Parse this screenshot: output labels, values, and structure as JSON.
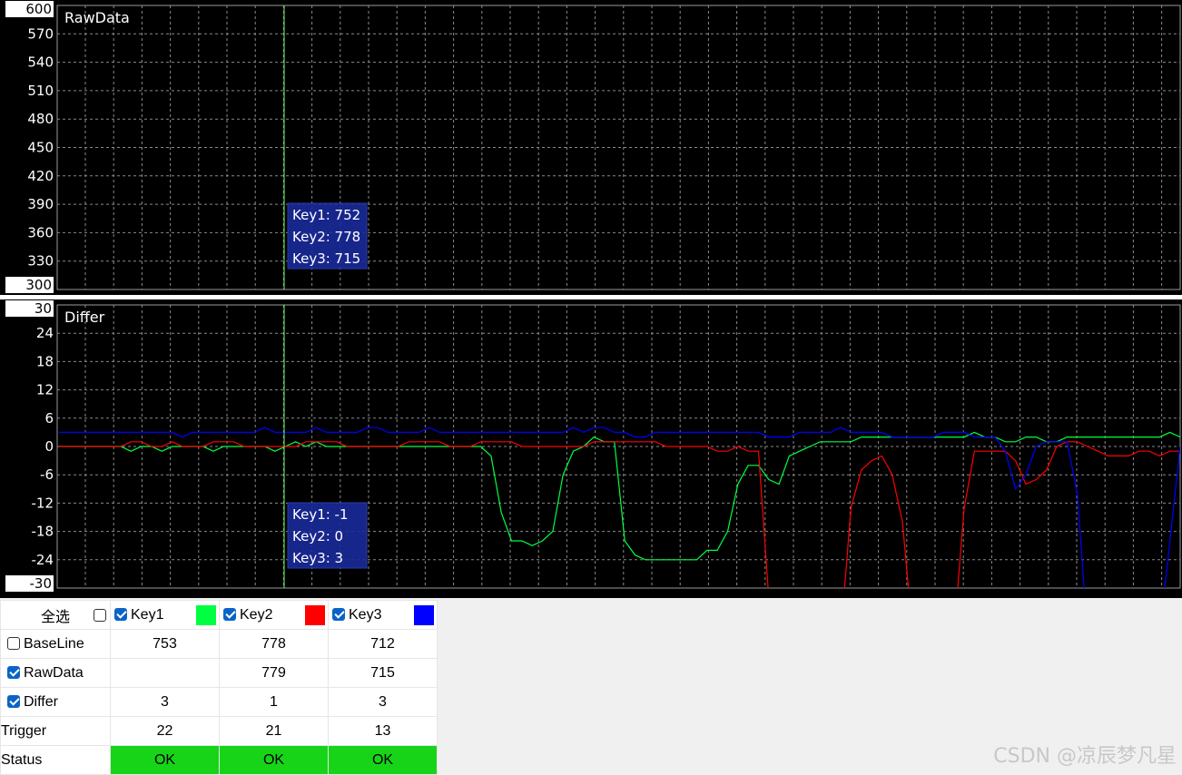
{
  "panels": [
    {
      "title": "RawData",
      "y_ticks": [
        "600",
        "570",
        "540",
        "510",
        "480",
        "450",
        "420",
        "390",
        "360",
        "330",
        "300"
      ],
      "tooltip": [
        "Key1: 752",
        "Key2: 778",
        "Key3: 715"
      ]
    },
    {
      "title": "Differ",
      "y_ticks": [
        "30",
        "24",
        "18",
        "12",
        "6",
        "0",
        "-6",
        "-12",
        "-18",
        "-24",
        "-30"
      ],
      "tooltip": [
        "Key1: -1",
        "Key2: 0",
        "Key3: 3"
      ]
    }
  ],
  "table": {
    "select_all": "全选",
    "keys": [
      {
        "label": "Key1",
        "color": "#00ff40",
        "checked": true
      },
      {
        "label": "Key2",
        "color": "#ff0000",
        "checked": true
      },
      {
        "label": "Key3",
        "color": "#0000ff",
        "checked": true
      }
    ],
    "rows": [
      {
        "label": "BaseLine",
        "checkbox": true,
        "checked": false,
        "values": [
          "753",
          "778",
          "712"
        ]
      },
      {
        "label": "RawData",
        "checkbox": true,
        "checked": true,
        "values": [
          "",
          "779",
          "715"
        ]
      },
      {
        "label": "Differ",
        "checkbox": true,
        "checked": true,
        "values": [
          "3",
          "1",
          "3"
        ]
      },
      {
        "label": "Trigger",
        "checkbox": false,
        "values": [
          "22",
          "21",
          "13"
        ]
      },
      {
        "label": "Status",
        "checkbox": false,
        "values": [
          "OK",
          "OK",
          "OK"
        ]
      }
    ]
  },
  "watermark": "CSDN @凉辰梦凡星",
  "chart_data": [
    {
      "type": "line",
      "title": "RawData",
      "ylim": [
        300,
        600
      ],
      "grid": true,
      "series": [
        {
          "name": "Key1",
          "color": "#00ff40",
          "values": []
        },
        {
          "name": "Key2",
          "color": "#ff0000",
          "values": []
        },
        {
          "name": "Key3",
          "color": "#0000ff",
          "values": []
        }
      ]
    },
    {
      "type": "line",
      "title": "Differ",
      "ylim": [
        -30,
        30
      ],
      "grid": true,
      "series": [
        {
          "name": "Key1",
          "color": "#00ff40",
          "values": [
            0,
            0,
            0,
            0,
            0,
            0,
            0,
            -1,
            0,
            0,
            -1,
            0,
            0,
            0,
            0,
            -1,
            0,
            0,
            0,
            0,
            0,
            -1,
            0,
            1,
            0,
            1,
            0,
            0,
            0,
            0,
            0,
            0,
            0,
            0,
            0,
            0,
            0,
            0,
            0,
            0,
            0,
            0,
            -2,
            -14,
            -20,
            -20,
            -21,
            -20,
            -18,
            -6,
            -1,
            0,
            2,
            1,
            1,
            -20,
            -23,
            -24,
            -24,
            -24,
            -24,
            -24,
            -24,
            -22,
            -22,
            -18,
            -8,
            -4,
            -4,
            -7,
            -8,
            -2,
            -1,
            0,
            1,
            1,
            1,
            1,
            2,
            2,
            2,
            2,
            2,
            2,
            2,
            2,
            2,
            2,
            2,
            3,
            2,
            2,
            1,
            1,
            2,
            2,
            1,
            1,
            2,
            2,
            2,
            2,
            2,
            2,
            2,
            2,
            2,
            2,
            3,
            2
          ]
        },
        {
          "name": "Key2",
          "color": "#ff0000",
          "values": [
            0,
            0,
            0,
            0,
            0,
            0,
            0,
            1,
            1,
            0,
            0,
            1,
            0,
            0,
            0,
            1,
            1,
            1,
            0,
            0,
            0,
            0,
            0,
            0,
            1,
            1,
            1,
            1,
            0,
            0,
            0,
            0,
            0,
            0,
            1,
            1,
            1,
            1,
            0,
            0,
            0,
            1,
            1,
            1,
            1,
            0,
            0,
            0,
            0,
            0,
            0,
            0,
            1,
            1,
            1,
            1,
            1,
            1,
            1,
            0,
            0,
            0,
            0,
            0,
            -1,
            -1,
            0,
            -1,
            -1,
            -32,
            -40,
            -40,
            -40,
            -40,
            -40,
            -40,
            -40,
            -13,
            -5,
            -3,
            -2,
            -6,
            -16,
            -40,
            -40,
            -40,
            -40,
            -40,
            -13,
            -1,
            -1,
            -1,
            -1,
            -3,
            -8,
            -7,
            -5,
            0,
            1,
            1,
            0,
            -1,
            -2,
            -2,
            -2,
            -1,
            -1,
            -2,
            -1,
            -1
          ]
        },
        {
          "name": "Key3",
          "color": "#0000ff",
          "values": [
            3,
            3,
            3,
            3,
            3,
            3,
            3,
            3,
            3,
            3,
            3,
            3,
            2,
            3,
            3,
            3,
            3,
            3,
            3,
            3,
            4,
            3,
            3,
            3,
            3,
            4,
            3,
            3,
            3,
            3,
            4,
            4,
            3,
            3,
            3,
            3,
            4,
            3,
            3,
            3,
            3,
            3,
            3,
            3,
            3,
            3,
            3,
            3,
            3,
            3,
            4,
            3,
            4,
            4,
            3,
            3,
            2,
            2,
            3,
            3,
            3,
            3,
            3,
            3,
            3,
            3,
            3,
            3,
            3,
            2,
            2,
            2,
            3,
            3,
            3,
            3,
            4,
            3,
            3,
            3,
            3,
            2,
            2,
            2,
            2,
            2,
            3,
            3,
            3,
            2,
            2,
            2,
            -1,
            -9,
            -6,
            0,
            1,
            1,
            1,
            -10,
            -40,
            -40,
            -40,
            -40,
            -40,
            -40,
            -40,
            -40,
            -20,
            0
          ]
        }
      ]
    }
  ]
}
